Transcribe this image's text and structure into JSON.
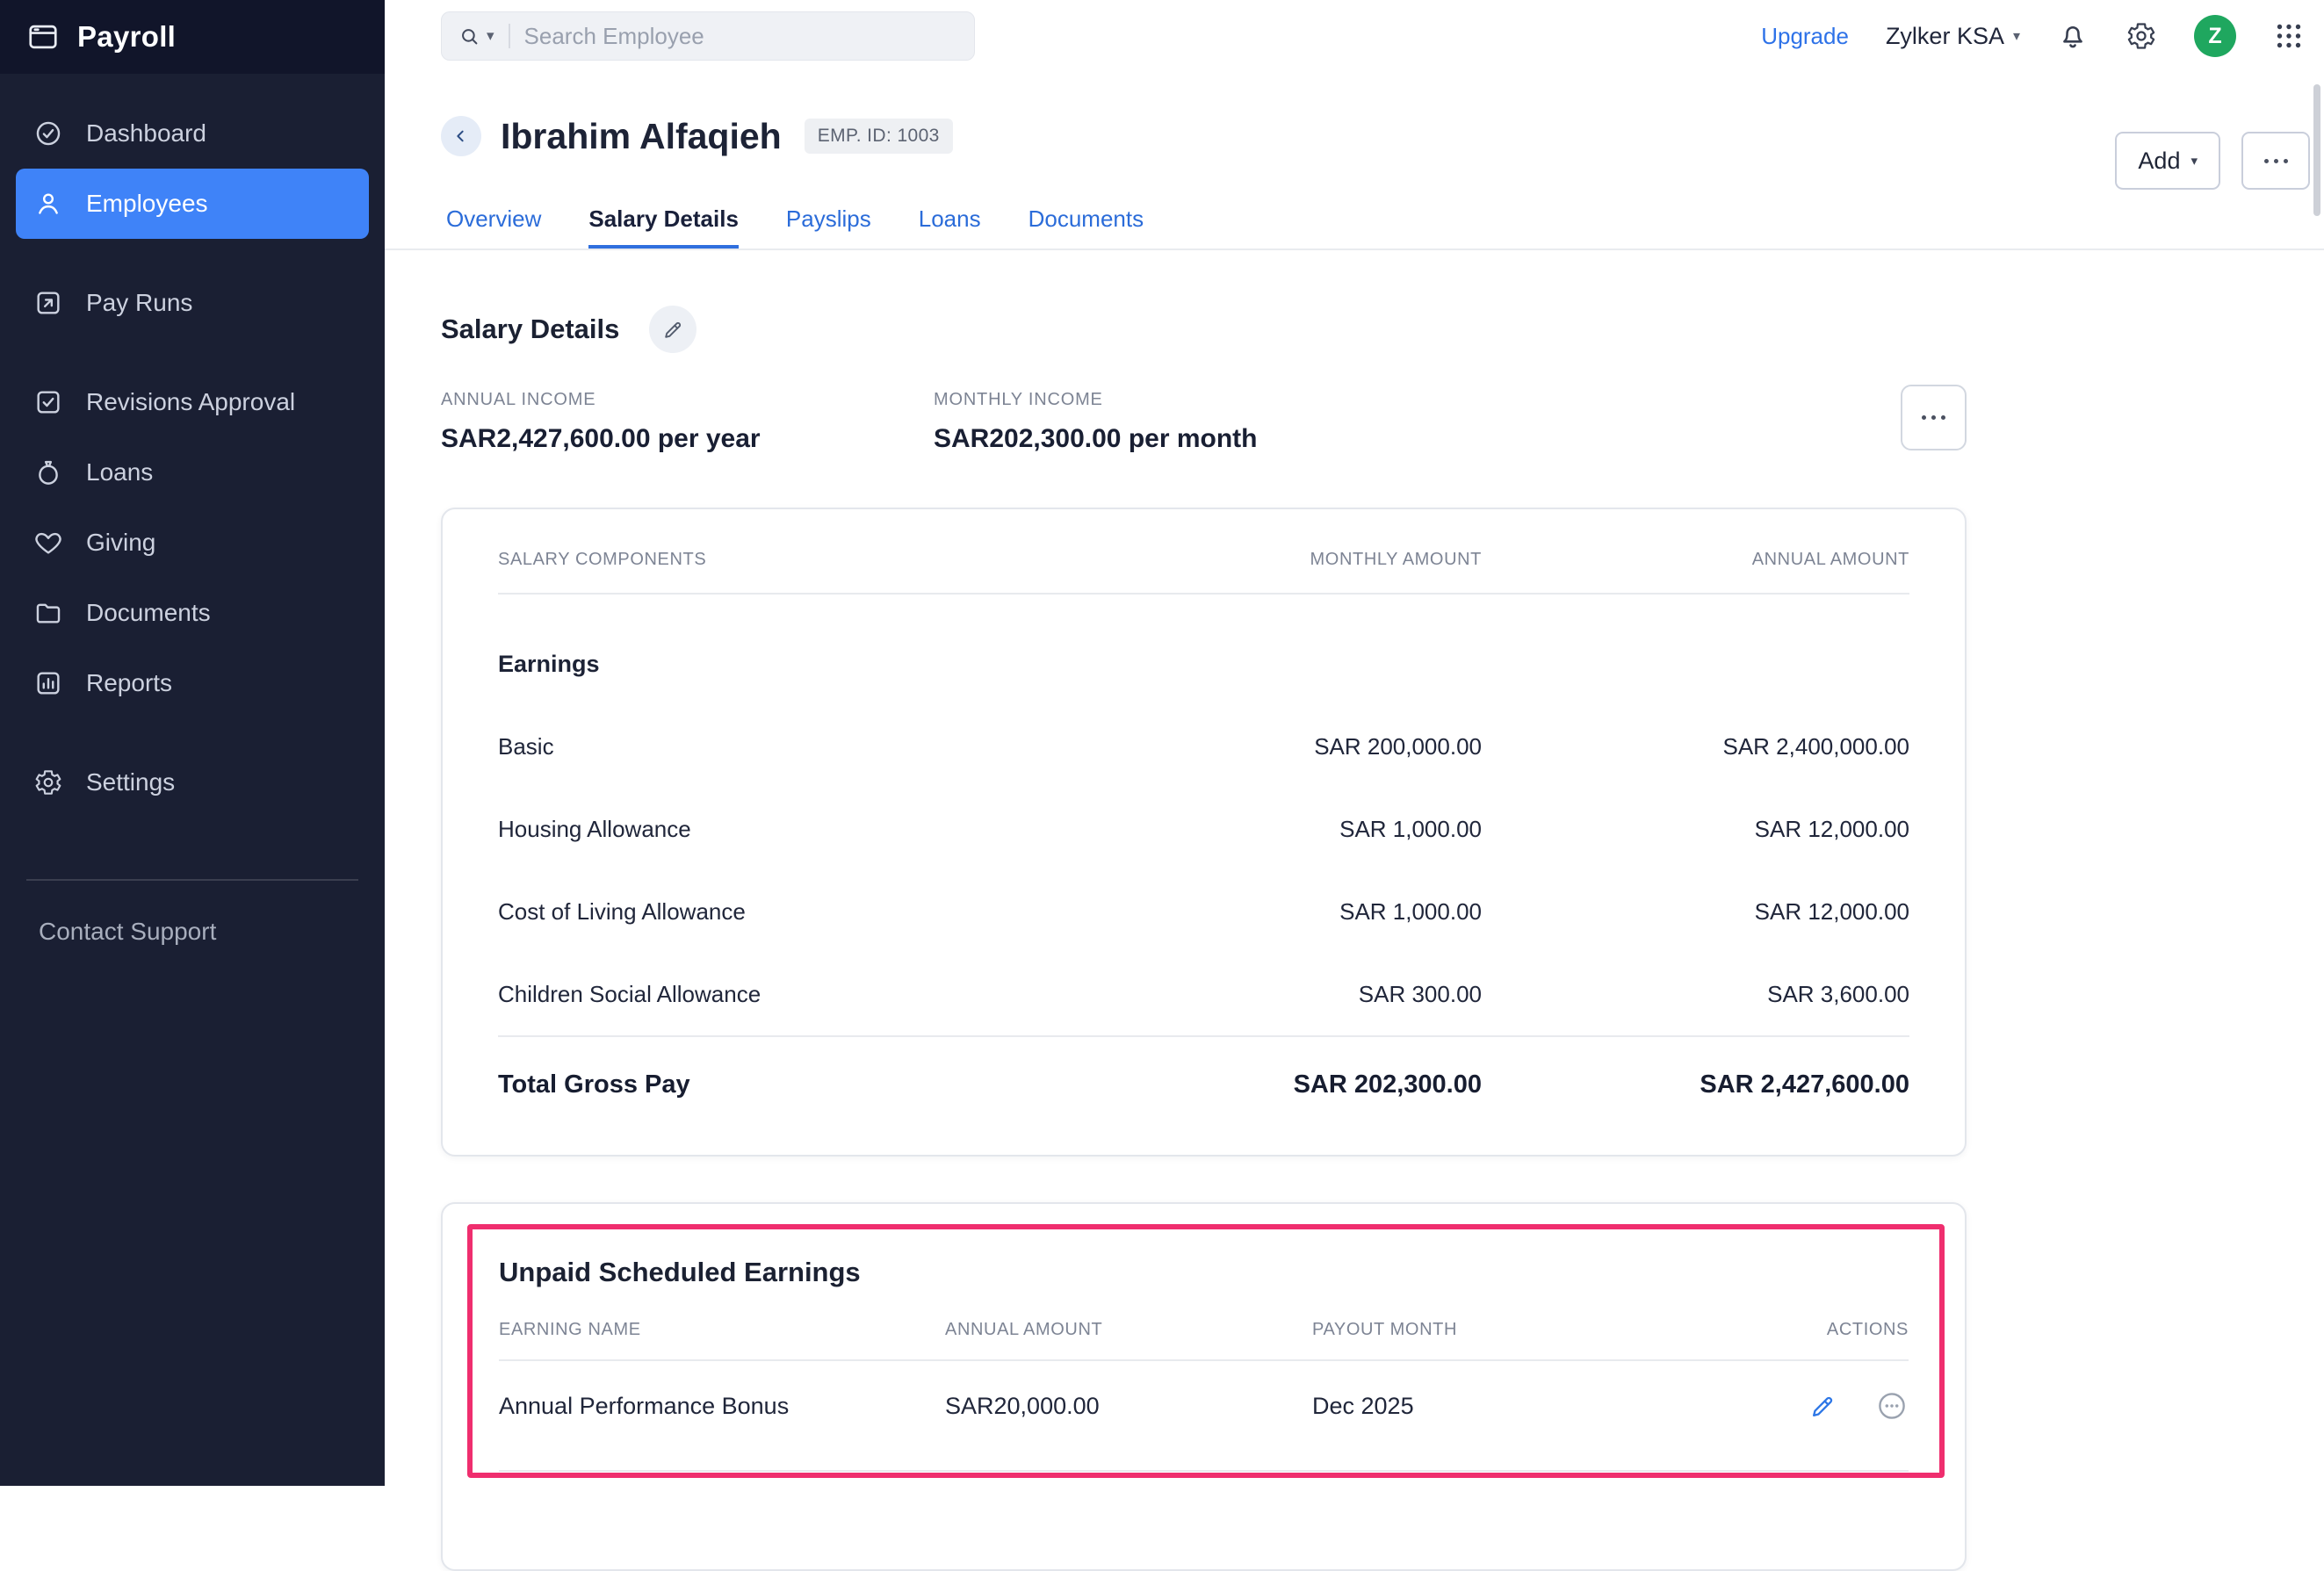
{
  "app": {
    "title": "Payroll"
  },
  "colors": {
    "sidebar_bg": "#1a1f33",
    "active_item_blue": "#3f83f8",
    "link_blue": "#2e72e8",
    "avatar_green": "#1fa75f",
    "highlight_pink": "#ef2e6e",
    "active_tab_underline": "#2f6fde"
  },
  "sidebar": {
    "items": [
      {
        "label": "Dashboard",
        "icon": "dashboard-icon"
      },
      {
        "label": "Employees",
        "icon": "employees-icon",
        "active": true
      },
      {
        "label": "Pay Runs",
        "icon": "pay-runs-icon"
      },
      {
        "label": "Revisions Approval",
        "icon": "revisions-approval-icon"
      },
      {
        "label": "Loans",
        "icon": "loans-icon"
      },
      {
        "label": "Giving",
        "icon": "giving-icon"
      },
      {
        "label": "Documents",
        "icon": "documents-icon"
      },
      {
        "label": "Reports",
        "icon": "reports-icon"
      },
      {
        "label": "Settings",
        "icon": "settings-icon"
      }
    ],
    "contact_support": "Contact Support"
  },
  "topbar": {
    "search_placeholder": "Search Employee",
    "upgrade_label": "Upgrade",
    "org_name": "Zylker KSA",
    "avatar_initial": "Z",
    "icons": [
      "search-icon",
      "notifications-bell-icon",
      "gear-icon",
      "apps-grid-icon"
    ]
  },
  "header": {
    "employee_name": "Ibrahim Alfaqieh",
    "emp_id_badge": "EMP. ID: 1003",
    "add_button": "Add",
    "tabs": [
      {
        "label": "Overview",
        "active": false
      },
      {
        "label": "Salary Details",
        "active": true
      },
      {
        "label": "Payslips",
        "active": false
      },
      {
        "label": "Loans",
        "active": false
      },
      {
        "label": "Documents",
        "active": false
      }
    ]
  },
  "salary": {
    "section_title": "Salary Details",
    "annual_income_label": "ANNUAL INCOME",
    "annual_income_value": "SAR2,427,600.00 per year",
    "monthly_income_label": "MONTHLY INCOME",
    "monthly_income_value": "SAR202,300.00 per month",
    "components_table": {
      "headers": [
        "SALARY COMPONENTS",
        "MONTHLY AMOUNT",
        "ANNUAL AMOUNT"
      ],
      "group_label": "Earnings",
      "rows": [
        {
          "name": "Basic",
          "monthly": "SAR 200,000.00",
          "annual": "SAR 2,400,000.00"
        },
        {
          "name": "Housing Allowance",
          "monthly": "SAR 1,000.00",
          "annual": "SAR 12,000.00"
        },
        {
          "name": "Cost of Living Allowance",
          "monthly": "SAR 1,000.00",
          "annual": "SAR 12,000.00"
        },
        {
          "name": "Children Social Allowance",
          "monthly": "SAR 300.00",
          "annual": "SAR 3,600.00"
        }
      ],
      "total": {
        "name": "Total Gross Pay",
        "monthly": "SAR 202,300.00",
        "annual": "SAR 2,427,600.00"
      }
    }
  },
  "unpaid_scheduled_earnings": {
    "title": "Unpaid Scheduled Earnings",
    "headers": [
      "EARNING NAME",
      "ANNUAL AMOUNT",
      "PAYOUT MONTH",
      "ACTIONS"
    ],
    "rows": [
      {
        "name": "Annual Performance Bonus",
        "annual_amount": "SAR20,000.00",
        "payout_month": "Dec 2025"
      }
    ],
    "row_action_icons": [
      "edit-pencil-icon",
      "more-options-icon"
    ],
    "highlight_color": "#ef2e6e"
  }
}
